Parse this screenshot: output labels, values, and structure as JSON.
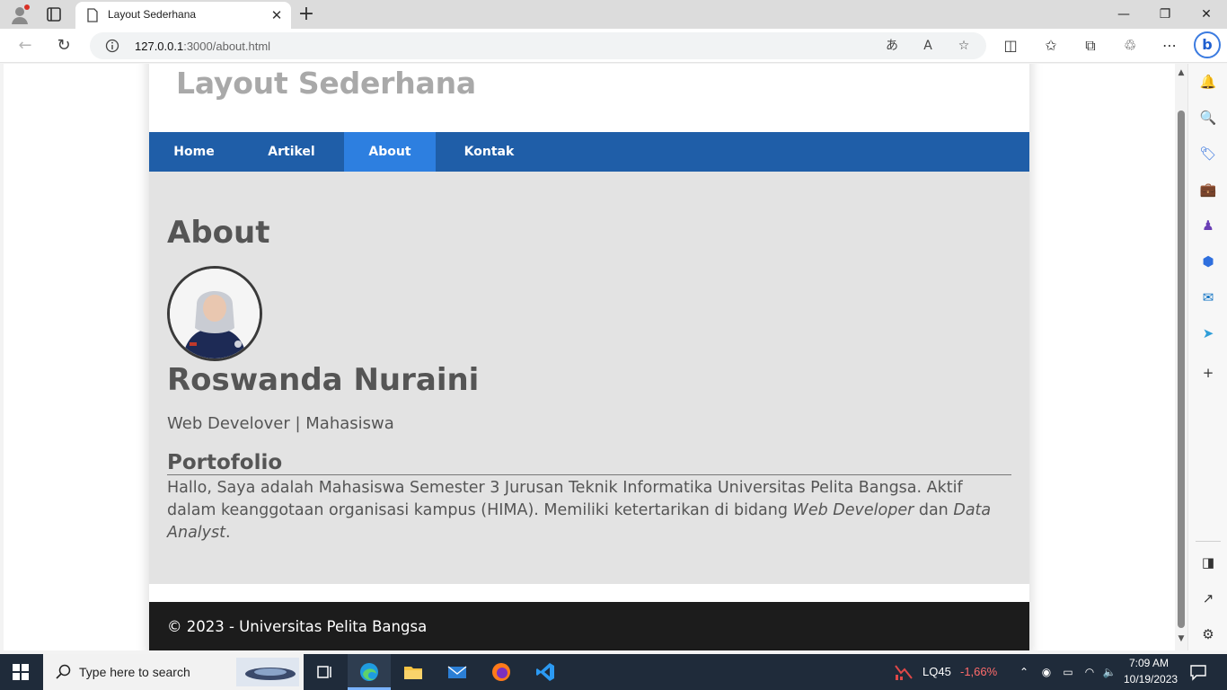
{
  "browser": {
    "tab_title": "Layout Sederhana",
    "url_host": "127.0.0.1",
    "url_path": ":3000/about.html"
  },
  "site": {
    "title": "Layout Sederhana",
    "nav": [
      {
        "label": "Home",
        "active": false
      },
      {
        "label": "Artikel",
        "active": false
      },
      {
        "label": "About",
        "active": true
      },
      {
        "label": "Kontak",
        "active": false
      }
    ],
    "heading": "About",
    "profile": {
      "name": "Roswanda Nuraini",
      "role": "Web Develover | Mahasiswa"
    },
    "portfolio": {
      "heading": "Portofolio",
      "text_part1": "Hallo, Saya adalah Mahasiswa Semester 3 Jurusan Teknik Informatika Universitas Pelita Bangsa. Aktif dalam keanggotaan organisasi kampus (HIMA). Memiliki ketertarikan di bidang ",
      "em1": "Web Developer",
      "text_part2": " dan ",
      "em2": "Data Analyst",
      "text_part3": "."
    },
    "footer": "© 2023 - Universitas Pelita Bangsa"
  },
  "taskbar": {
    "search_placeholder": "Type here to search",
    "stock_name": "LQ45",
    "stock_change": "-1,66%",
    "time": "7:09 AM",
    "date": "10/19/2023"
  },
  "colors": {
    "nav_bg": "#1f5ea8",
    "nav_active": "#2d7fe0",
    "main_bg": "#e3e3e3",
    "footer_bg": "#1c1c1c",
    "text": "#555555"
  }
}
